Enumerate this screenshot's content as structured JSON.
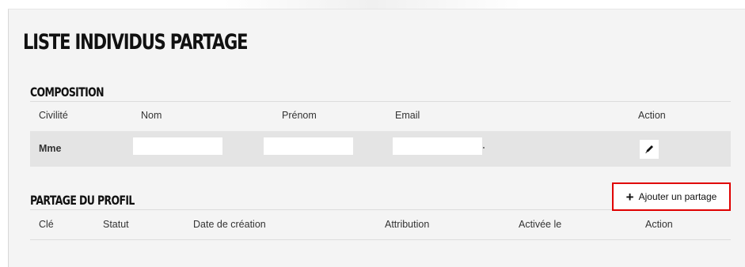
{
  "page": {
    "title": "LISTE INDIVIDUS PARTAGE"
  },
  "composition": {
    "title": "COMPOSITION",
    "columns": [
      "Civilité",
      "Nom",
      "Prénom",
      "Email",
      "Action"
    ],
    "rows": [
      {
        "civilite": "Mme",
        "nom": "",
        "prenom": "",
        "email": "",
        "action_icon": "pencil-icon"
      }
    ]
  },
  "partage": {
    "title": "PARTAGE DU PROFIL",
    "add_button": {
      "icon": "plus-icon",
      "label": "Ajouter un partage",
      "highlight_color": "#e00000"
    },
    "columns": [
      "Clé",
      "Statut",
      "Date de création",
      "Attribution",
      "Activée le",
      "Action"
    ],
    "rows": []
  }
}
